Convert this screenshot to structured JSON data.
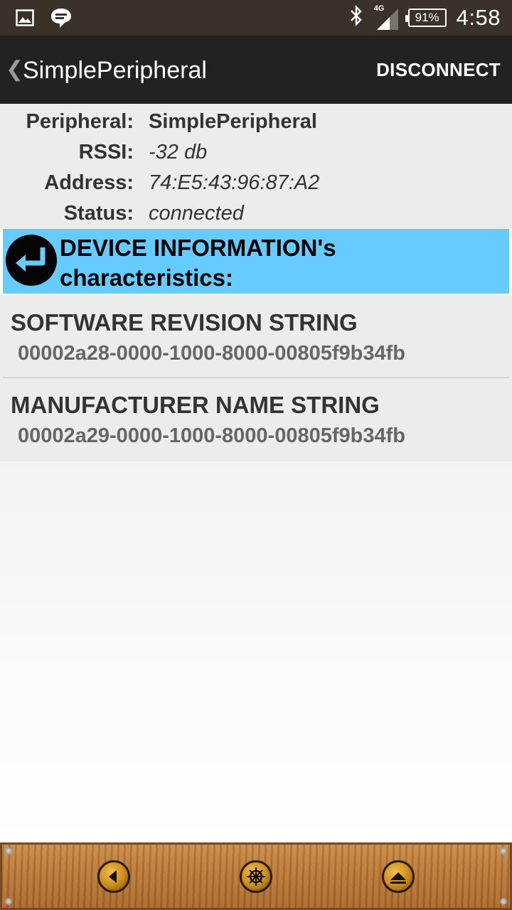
{
  "status_bar": {
    "time": "4:58",
    "battery": "91%",
    "network_type": "4G",
    "icons": [
      "gallery-icon",
      "chat-icon",
      "bluetooth-icon",
      "signal-icon",
      "battery-icon"
    ]
  },
  "action_bar": {
    "title": "SimplePeripheral",
    "back_glyph": "❮",
    "disconnect_label": "DISCONNECT"
  },
  "peripheral": {
    "rows": [
      {
        "label": "Peripheral:",
        "value": "SimplePeripheral"
      },
      {
        "label": "RSSI:",
        "value": "-32 db"
      },
      {
        "label": "Address:",
        "value": "74:E5:43:96:87:A2"
      },
      {
        "label": "Status:",
        "value": "connected"
      }
    ]
  },
  "service": {
    "title": "DEVICE INFORMATION's characteristics:",
    "icon": "return-arrow-icon",
    "color": "#66ccff"
  },
  "characteristics": [
    {
      "name": "SOFTWARE REVISION STRING",
      "uuid": "00002a28-0000-1000-8000-00805f9b34fb"
    },
    {
      "name": "MANUFACTURER NAME STRING",
      "uuid": "00002a29-0000-1000-8000-00805f9b34fb"
    }
  ],
  "bottom_bar": {
    "buttons": [
      "back-arrow-icon",
      "ship-wheel-icon",
      "scroll-up-icon"
    ]
  }
}
